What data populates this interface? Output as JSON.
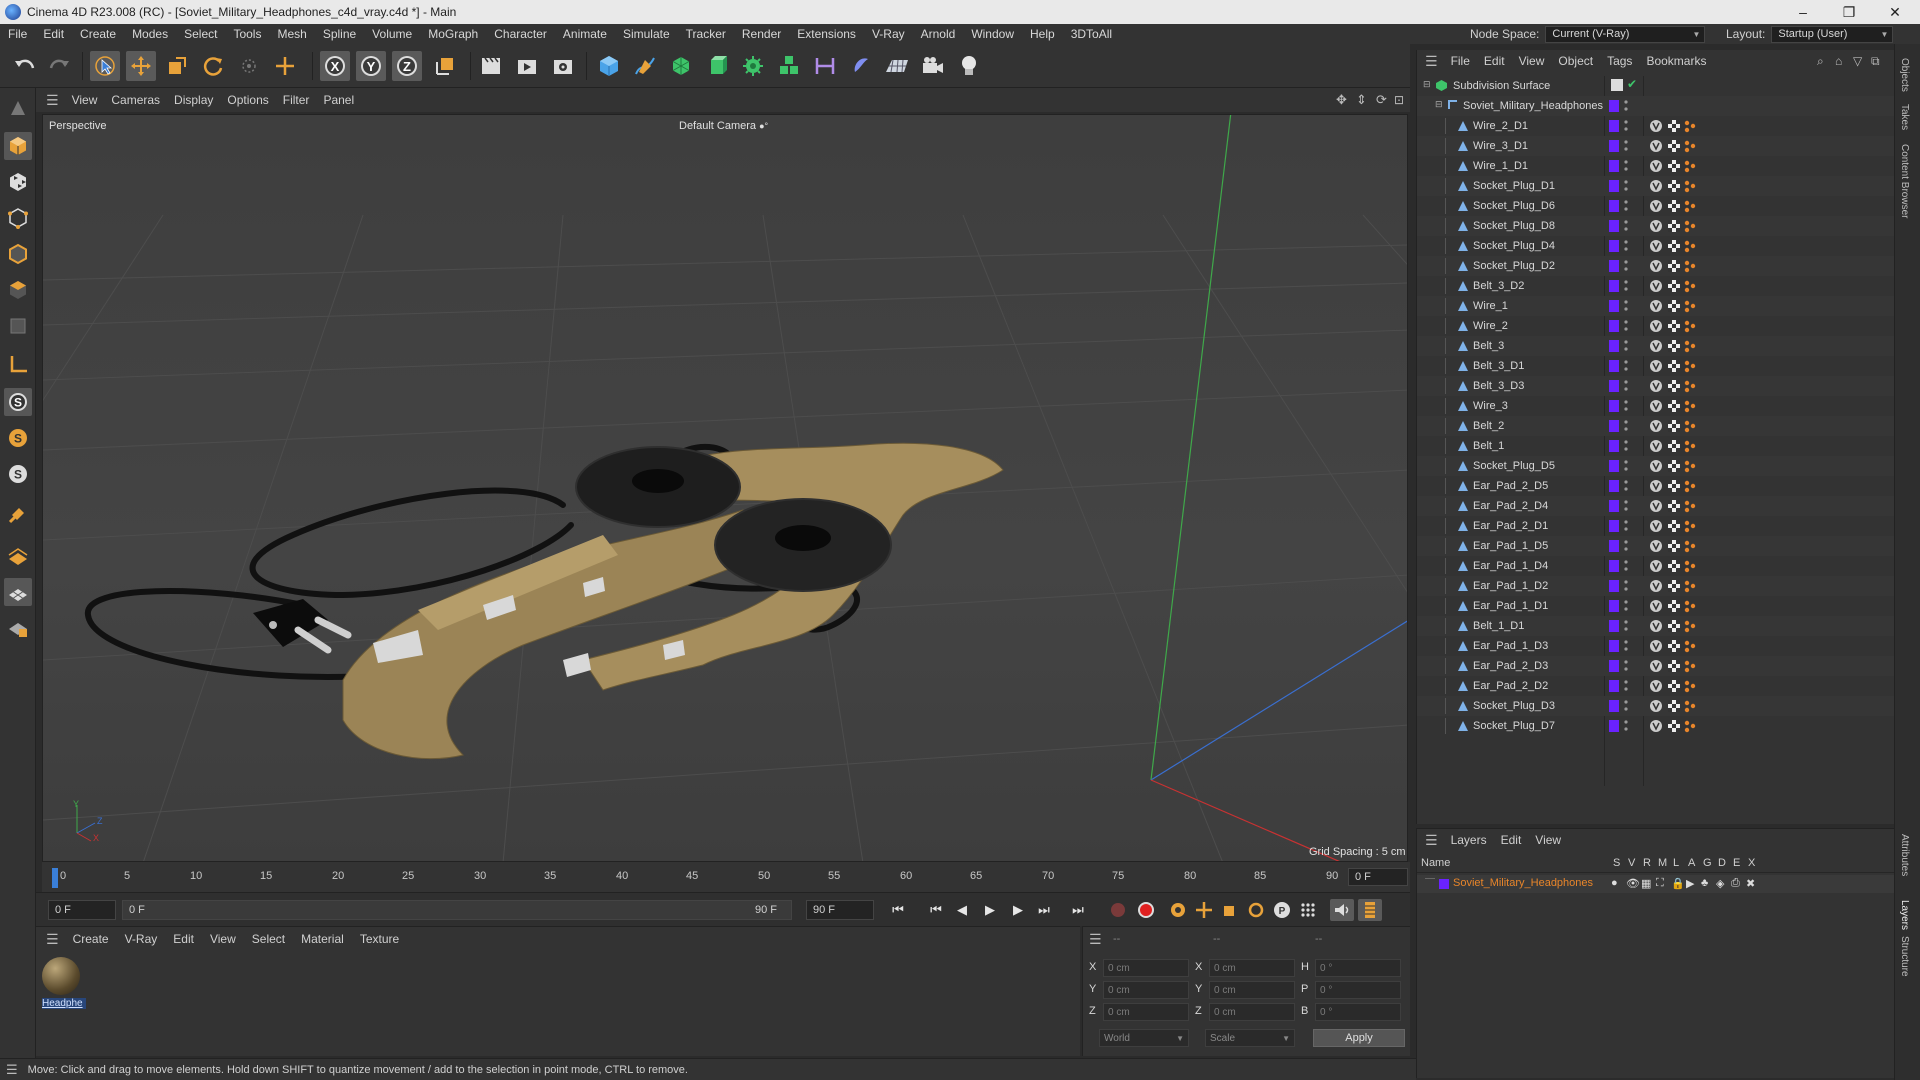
{
  "window": {
    "title": "Cinema 4D R23.008 (RC) - [Soviet_Military_Headphones_c4d_vray.c4d *] - Main",
    "controls": [
      "–",
      "❐",
      "✕"
    ]
  },
  "menubar": {
    "items": [
      "File",
      "Edit",
      "Create",
      "Modes",
      "Select",
      "Tools",
      "Mesh",
      "Spline",
      "Volume",
      "MoGraph",
      "Character",
      "Animate",
      "Simulate",
      "Tracker",
      "Render",
      "Extensions",
      "V-Ray",
      "Arnold",
      "Window",
      "Help",
      "3DToAll"
    ],
    "node_space_label": "Node Space:",
    "node_space_value": "Current (V-Ray)",
    "layout_label": "Layout:",
    "layout_value": "Startup (User)"
  },
  "viewport": {
    "menu": [
      "View",
      "Cameras",
      "Display",
      "Options",
      "Filter",
      "Panel"
    ],
    "projection_label": "Perspective",
    "camera_label": "Default Camera",
    "grid_spacing": "Grid Spacing : 5 cm",
    "axis_y": "Y",
    "axis_z": "Z",
    "axis_x": "X"
  },
  "timeline": {
    "ticks": [
      "0",
      "5",
      "10",
      "15",
      "20",
      "25",
      "30",
      "35",
      "40",
      "45",
      "50",
      "55",
      "60",
      "65",
      "70",
      "75",
      "80",
      "85",
      "90"
    ],
    "current_frame_display": "0 F",
    "start_field": "0 F",
    "range_start": "0 F",
    "range_end": "90 F",
    "end_field": "90 F"
  },
  "material_manager": {
    "menu": [
      "Create",
      "V-Ray",
      "Edit",
      "View",
      "Select",
      "Material",
      "Texture"
    ],
    "material_name": "Headphe"
  },
  "coordinates": {
    "header_cols": [
      "--",
      "--",
      "--"
    ],
    "rows": [
      {
        "a_label": "X",
        "a_value": "0 cm",
        "b_label": "X",
        "b_value": "0 cm",
        "c_label": "H",
        "c_value": "0 °"
      },
      {
        "a_label": "Y",
        "a_value": "0 cm",
        "b_label": "Y",
        "b_value": "0 cm",
        "c_label": "P",
        "c_value": "0 °"
      },
      {
        "a_label": "Z",
        "a_value": "0 cm",
        "b_label": "Z",
        "b_value": "0 cm",
        "c_label": "B",
        "c_value": "0 °"
      }
    ],
    "mode_world": "World",
    "mode_scale": "Scale",
    "apply_label": "Apply"
  },
  "statusbar": {
    "text": "Move: Click and drag to move elements. Hold down SHIFT to quantize movement / add to the selection in point mode, CTRL to remove."
  },
  "object_manager": {
    "menu": [
      "File",
      "Edit",
      "View",
      "Object",
      "Tags",
      "Bookmarks"
    ],
    "root": "Subdivision Surface",
    "group": "Soviet_Military_Headphones",
    "objects": [
      "Wire_2_D1",
      "Wire_3_D1",
      "Wire_1_D1",
      "Socket_Plug_D1",
      "Socket_Plug_D6",
      "Socket_Plug_D8",
      "Socket_Plug_D4",
      "Socket_Plug_D2",
      "Belt_3_D2",
      "Wire_1",
      "Wire_2",
      "Belt_3",
      "Belt_3_D1",
      "Belt_3_D3",
      "Wire_3",
      "Belt_2",
      "Belt_1",
      "Socket_Plug_D5",
      "Ear_Pad_2_D5",
      "Ear_Pad_2_D4",
      "Ear_Pad_2_D1",
      "Ear_Pad_1_D5",
      "Ear_Pad_1_D4",
      "Ear_Pad_1_D2",
      "Ear_Pad_1_D1",
      "Belt_1_D1",
      "Ear_Pad_1_D3",
      "Ear_Pad_2_D3",
      "Ear_Pad_2_D2",
      "Socket_Plug_D3",
      "Socket_Plug_D7"
    ],
    "accent_color": "#6a22ff"
  },
  "layer_manager": {
    "menu": [
      "Layers",
      "Edit",
      "View"
    ],
    "col_name": "Name",
    "flags": [
      "S",
      "V",
      "R",
      "M",
      "L",
      "A",
      "G",
      "D",
      "E",
      "X"
    ],
    "layer_name": "Soviet_Military_Headphones",
    "layer_color": "#e8852a"
  },
  "side_tabs": [
    "Objects",
    "Takes",
    "Content Browser",
    "Attributes",
    "Layers",
    "Structure"
  ]
}
